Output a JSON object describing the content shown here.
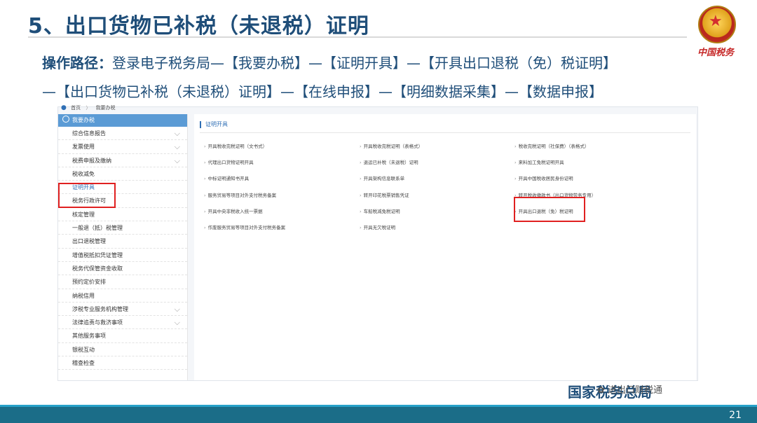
{
  "slide": {
    "title": "5、出口货物已补税（未退税）证明",
    "path_label": "操作路径：",
    "path_line1": "登录电子税务局—【我要办税】—【证明开具】—【开具出口退税（免）税证明】",
    "path_line2": "—【出口货物已补税（未退税）证明】—【在线申报】—【明细数据采集】—【数据申报】",
    "brand_mark": "中国税务",
    "footer_brand": "国家税务总局",
    "wechat_account": "进出口财税通",
    "page_number": "21"
  },
  "screenshot": {
    "breadcrumb": [
      "首页",
      "我要办税"
    ],
    "sidebar_header": "我要办税",
    "sidebar_items": [
      {
        "label": "综合信息报告",
        "chevron": true
      },
      {
        "label": "发票使用",
        "chevron": true
      },
      {
        "label": "税费申报及缴纳",
        "chevron": true
      },
      {
        "label": "税收减免",
        "chevron": false
      },
      {
        "label": "证明开具",
        "chevron": false,
        "active": true
      },
      {
        "label": "税务行政许可",
        "chevron": false
      },
      {
        "label": "核定管理",
        "chevron": false
      },
      {
        "label": "一般退（抵）税管理",
        "chevron": false
      },
      {
        "label": "出口退税管理",
        "chevron": false
      },
      {
        "label": "增值税抵扣凭证管理",
        "chevron": false
      },
      {
        "label": "税务代保管资金收取",
        "chevron": false
      },
      {
        "label": "预约定价安排",
        "chevron": false
      },
      {
        "label": "纳税信用",
        "chevron": false
      },
      {
        "label": "涉税专业服务机构管理",
        "chevron": true
      },
      {
        "label": "法律追责与救济事项",
        "chevron": true
      },
      {
        "label": "其他服务事项",
        "chevron": false
      },
      {
        "label": "银税互动",
        "chevron": false
      },
      {
        "label": "稽查检查",
        "chevron": false
      }
    ],
    "main_title": "证明开具",
    "grid": [
      [
        "开具税收完税证明（文书式）",
        "开具税收完税证明（表格式）",
        "税收完税证明（社保费）（表格式）"
      ],
      [
        "代理出口货物证明开具",
        "退运已补税（未退税）证明",
        "来料加工免税证明开具"
      ],
      [
        "中标证明通知书开具",
        "开具架构信息联系单",
        "开具中国税收居民身份证明"
      ],
      [
        "服务贸易等项目对外支付税务备案",
        "转开印花税票销售凭证",
        "转开税收缴款书（出口货物劳务专用）"
      ],
      [
        "开具中央非税收入统一票据",
        "车船税减免税证明",
        "开具出口退税（免）税证明"
      ],
      [
        "作废服务贸易等项目对外支付税务备案",
        "开具无欠税证明",
        ""
      ]
    ]
  },
  "colors": {
    "title": "#1f4e79",
    "highlight": "#e02020",
    "footer_bar": "#1b6d88",
    "sidebar_header": "#5b9bd5"
  },
  "icons": {
    "breadcrumb_pin": "location-pin-icon",
    "emblem": "national-emblem-icon",
    "chevron": "chevron-down-icon",
    "wechat": "wechat-icon"
  }
}
